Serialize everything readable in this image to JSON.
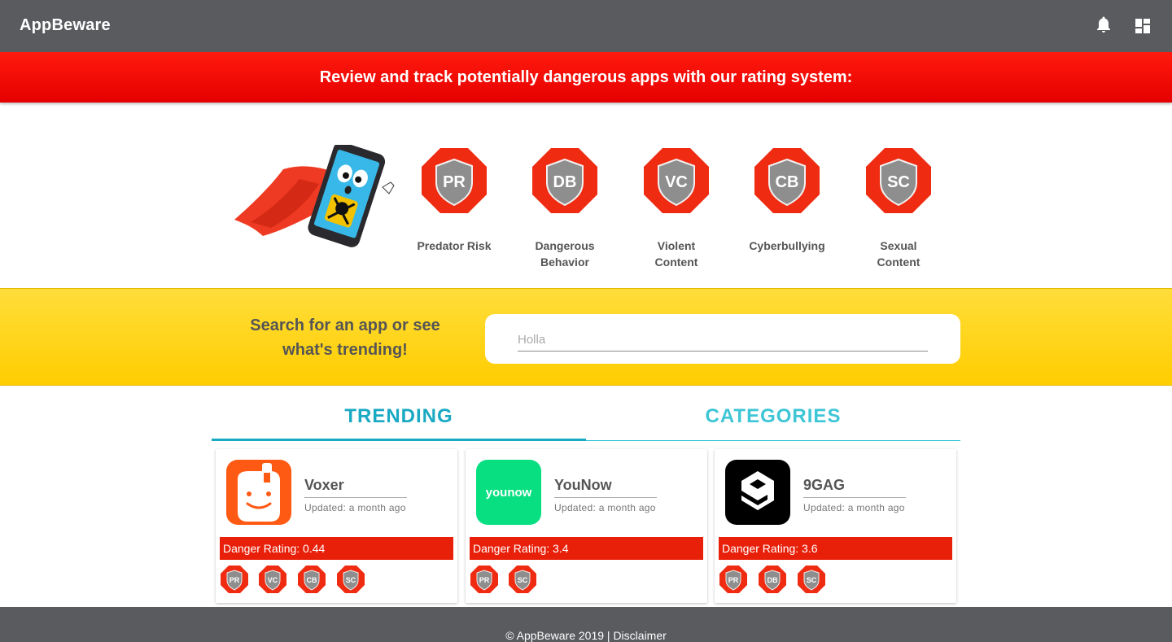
{
  "app": {
    "title": "AppBeware"
  },
  "header": {
    "bell_icon": "bell-icon",
    "dashboard_icon": "dashboard-icon"
  },
  "banner": {
    "text": "Review and track potentially dangerous apps with our rating system:"
  },
  "rating_badges": [
    {
      "code": "PR",
      "label": "Predator Risk"
    },
    {
      "code": "DB",
      "label": "Dangerous Behavior"
    },
    {
      "code": "VC",
      "label": "Violent Content"
    },
    {
      "code": "CB",
      "label": "Cyberbullying"
    },
    {
      "code": "SC",
      "label": "Sexual Content"
    }
  ],
  "search": {
    "prompt": "Search for an app or see what's trending!",
    "value": "",
    "placeholder": "Holla"
  },
  "tabs": [
    {
      "label": "TRENDING",
      "active": true
    },
    {
      "label": "CATEGORIES",
      "active": false
    }
  ],
  "apps": [
    {
      "name": "Voxer",
      "updated": "Updated: a month ago",
      "rating_text": "Danger Rating: 0.44",
      "rating": 0.44,
      "badges": [
        "PR",
        "VC",
        "CB",
        "SC"
      ],
      "icon_color": "#ff5a14"
    },
    {
      "name": "YouNow",
      "updated": "Updated: a month ago",
      "rating_text": "Danger Rating: 3.4",
      "rating": 3.4,
      "badges": [
        "PR",
        "SC"
      ],
      "icon_color": "#08df81",
      "icon_text": "younow"
    },
    {
      "name": "9GAG",
      "updated": "Updated: a month ago",
      "rating_text": "Danger Rating: 3.6",
      "rating": 3.6,
      "badges": [
        "PR",
        "DB",
        "SC"
      ],
      "icon_color": "#000000"
    }
  ],
  "footer": {
    "text": "© AppBeware 2019 | Disclaimer"
  },
  "colors": {
    "header": "#5a5b5f",
    "banner_red": "#ff1a0e",
    "search_yellow": "#ffd21a",
    "tab_cyan": "#1aa9c3",
    "rating_red": "#e8200a"
  }
}
